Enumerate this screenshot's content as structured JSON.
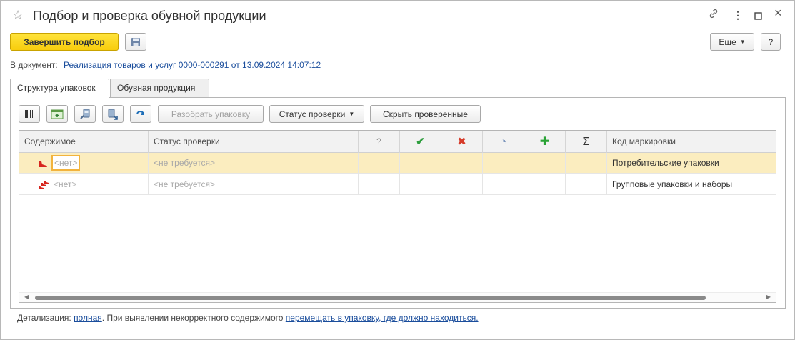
{
  "window": {
    "title": "Подбор и проверка обувной продукции"
  },
  "toolbar": {
    "finish_label": "Завершить подбор",
    "more_label": "Еще",
    "help_label": "?"
  },
  "document": {
    "label": "В документ:",
    "link": "Реализация товаров и услуг 0000-000291 от 13.09.2024 14:07:12"
  },
  "tabs": [
    {
      "label": "Структура упаковок",
      "active": true
    },
    {
      "label": "Обувная продукция",
      "active": false
    }
  ],
  "panel_toolbar": {
    "disassemble_label": "Разобрать упаковку",
    "status_label": "Статус проверки",
    "hide_checked_label": "Скрыть проверенные"
  },
  "grid": {
    "columns": [
      "Содержимое",
      "Статус проверки",
      "?",
      "✔",
      "✖",
      "◔",
      "✚",
      "Σ",
      "Код маркировки"
    ],
    "rows": [
      {
        "content": "<нет>",
        "status": "<не требуется>",
        "code": "Потребительские упаковки",
        "selected": true
      },
      {
        "content": "<нет>",
        "status": "<не требуется>",
        "code": "Групповые упаковки и наборы",
        "selected": false
      }
    ]
  },
  "footer": {
    "prefix": "Детализация: ",
    "detail_link": "полная",
    "middle": ". При выявлении некорректного содержимого ",
    "action_link": "перемещать в упаковку, где должно находиться."
  },
  "colors": {
    "primary_button": "#f8cd0d",
    "selected_row": "#fbedbf",
    "check_green": "#2e9e3e",
    "cross_red": "#d63b2a",
    "link": "#1a4d9c"
  }
}
